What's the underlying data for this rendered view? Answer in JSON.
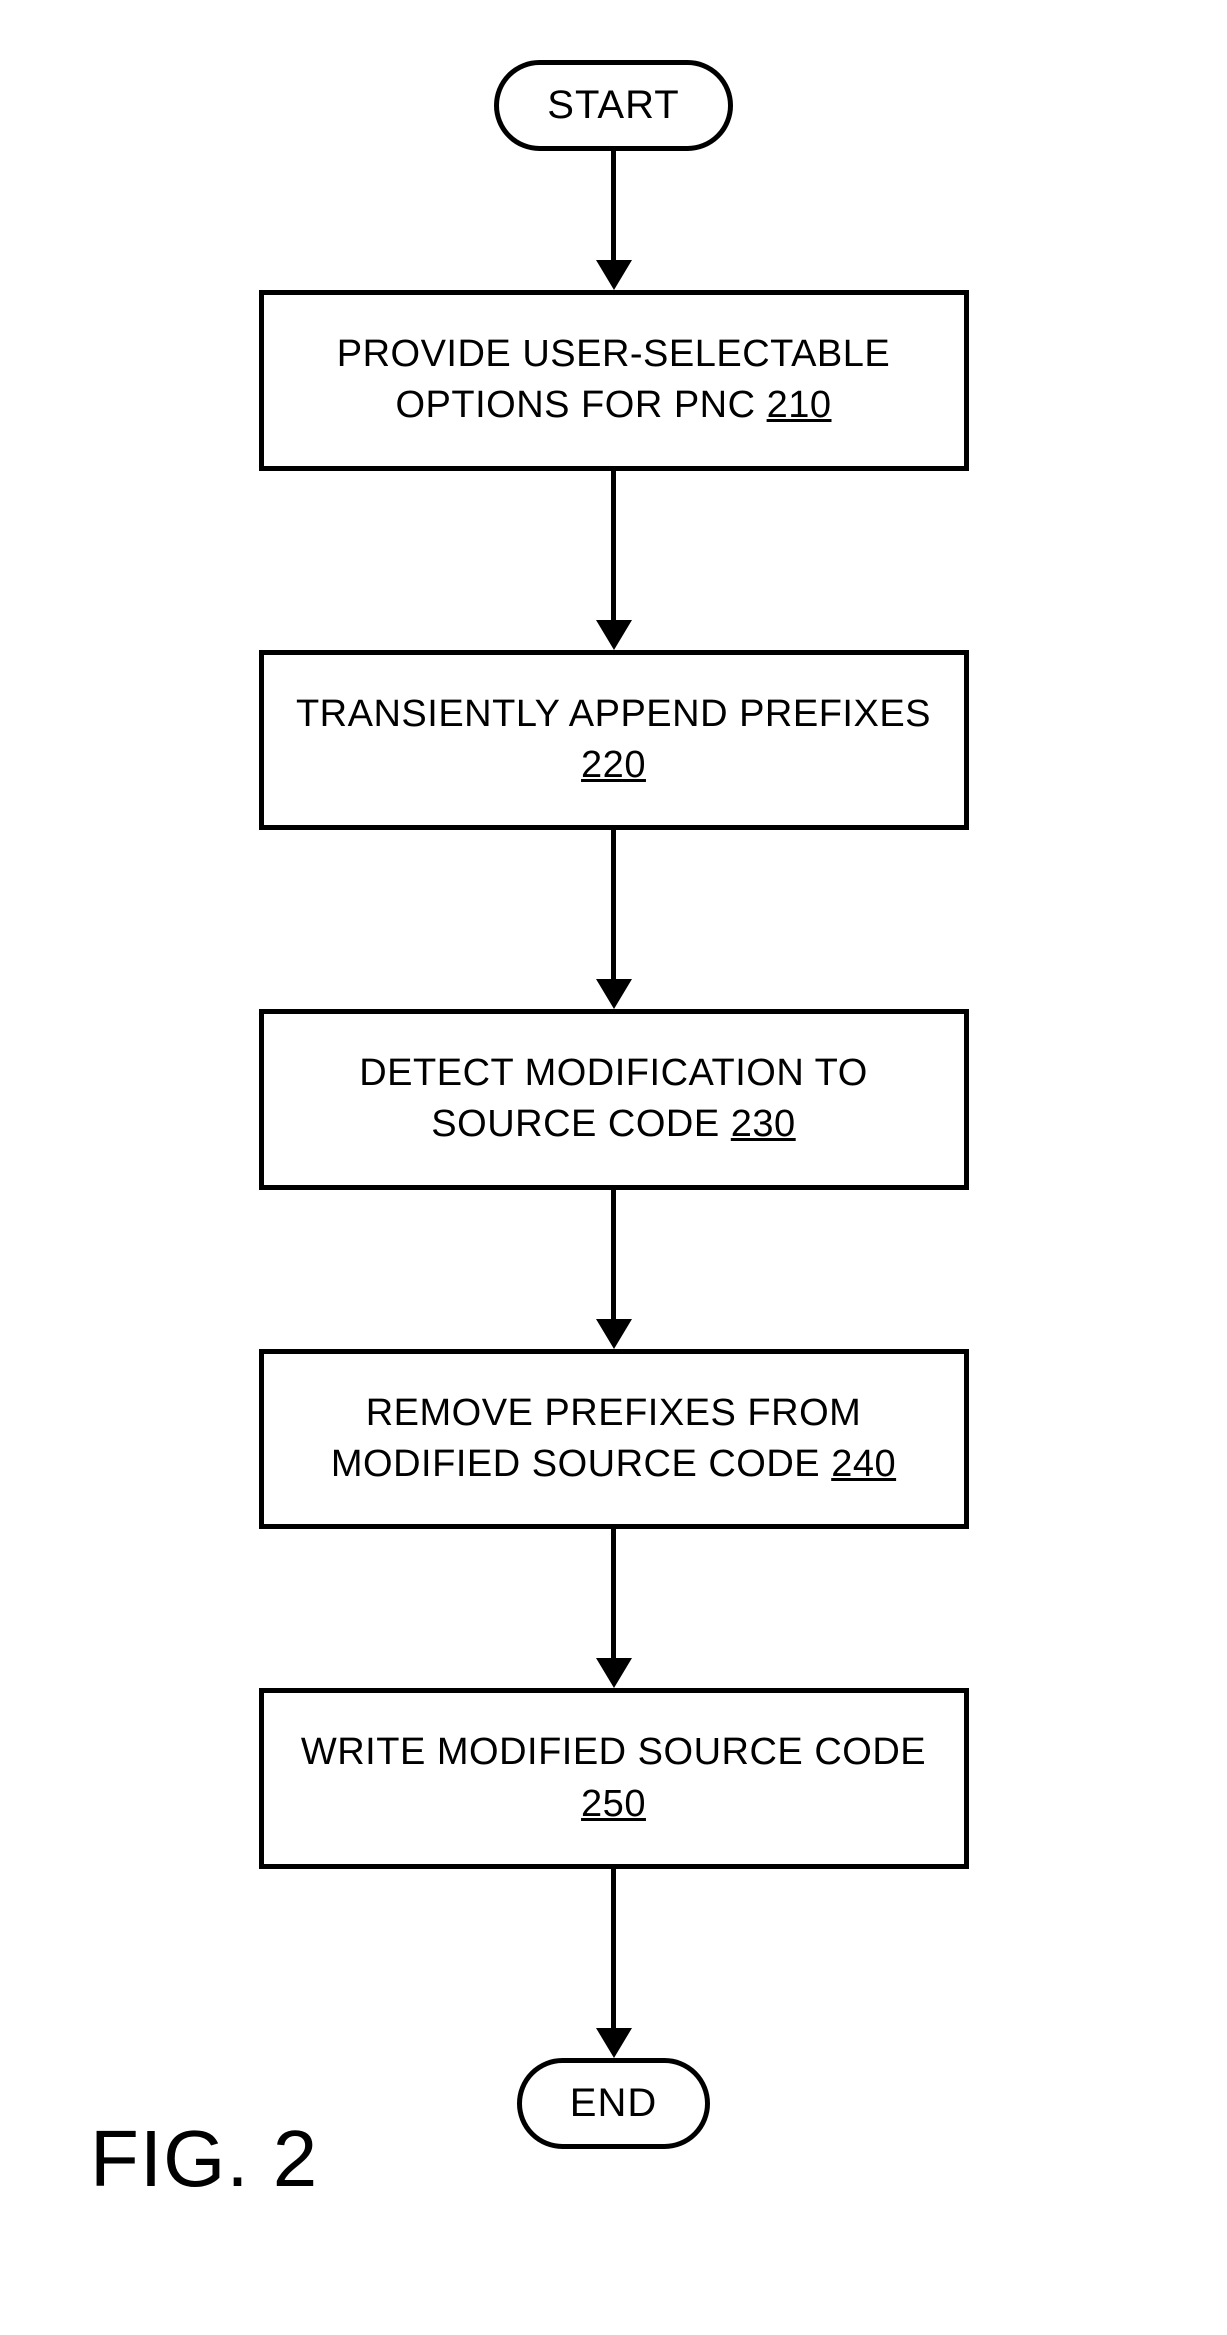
{
  "flow": {
    "start": "START",
    "end": "END",
    "steps": [
      {
        "text": "PROVIDE USER-SELECTABLE OPTIONS FOR PNC",
        "ref": "210"
      },
      {
        "text": "TRANSIENTLY APPEND PREFIXES",
        "ref": "220"
      },
      {
        "text": "DETECT MODIFICATION TO SOURCE CODE",
        "ref": "230"
      },
      {
        "text": "REMOVE PREFIXES FROM MODIFIED SOURCE CODE",
        "ref": "240"
      },
      {
        "text": "WRITE MODIFIED SOURCE CODE",
        "ref": "250"
      }
    ]
  },
  "figure_label": "FIG. 2"
}
